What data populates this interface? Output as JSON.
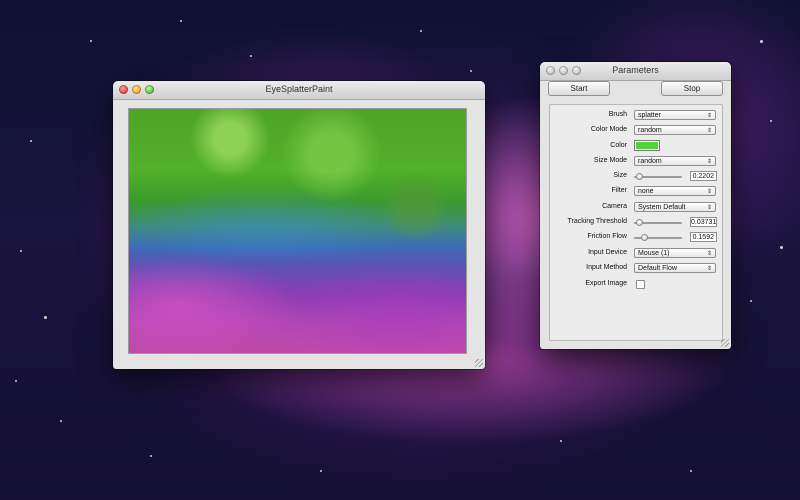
{
  "paint_window": {
    "title": "EyeSplatterPaint"
  },
  "params_window": {
    "title": "Parameters",
    "start_label": "Start",
    "stop_label": "Stop",
    "brush": {
      "label": "Brush",
      "value": "splatter"
    },
    "color_mode": {
      "label": "Color Mode",
      "value": "random"
    },
    "color": {
      "label": "Color",
      "value": "#4fd23a"
    },
    "size_mode": {
      "label": "Size Mode",
      "value": "random"
    },
    "size": {
      "label": "Size",
      "value": "0.2202",
      "level": 0.05
    },
    "filter": {
      "label": "Filter",
      "value": "none"
    },
    "camera": {
      "label": "Camera",
      "value": "System Default"
    },
    "tracking_threshold": {
      "label": "Tracking Threshold",
      "value": "0.03731",
      "level": 0.04
    },
    "friction_flow": {
      "label": "Friction Flow",
      "value": "0.1592",
      "level": 0.16
    },
    "input_device": {
      "label": "Input Device",
      "value": "Mouse (1)"
    },
    "input_method": {
      "label": "Input Method",
      "value": "Default Flow"
    },
    "export_image": {
      "label": "Export Image",
      "checked": false
    }
  },
  "icons": {
    "close": "close-light-icon",
    "minimize": "minimize-light-icon",
    "zoom": "zoom-light-icon",
    "popup_arrow": "updown-arrow-icon",
    "resize": "resize-grip-icon"
  }
}
